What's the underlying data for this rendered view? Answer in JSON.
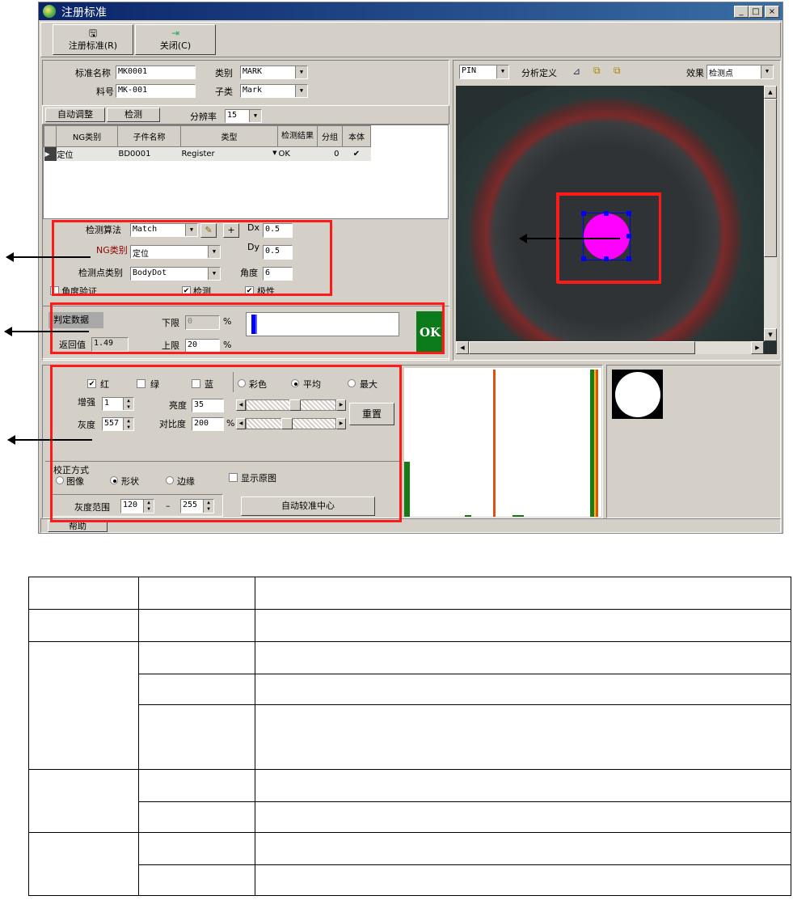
{
  "window": {
    "title": "注册标准",
    "min": "_",
    "max": "□",
    "close": "×"
  },
  "toolbar": {
    "register_label": "注册标准(R)",
    "close_label": "关闭(C)"
  },
  "standard": {
    "name_label": "标准名称",
    "name_value": "MK0001",
    "part_label": "料号",
    "part_value": "MK-001",
    "category_label": "类别",
    "category_value": "MARK",
    "subclass_label": "子类",
    "subclass_value": "Mark"
  },
  "actions": {
    "auto_adjust": "自动调整",
    "detect": "检测",
    "resolution_label": "分辨率",
    "resolution_value": "15"
  },
  "grid": {
    "headers": [
      "NG类别",
      "子件名称",
      "类型",
      "检测结果",
      "分组",
      "本体"
    ],
    "rows": [
      {
        "ng": "定位",
        "name": "BD0001",
        "type": "Register",
        "result": "OK",
        "group": "0",
        "body": "✔"
      }
    ]
  },
  "algo": {
    "method_label": "检测算法",
    "method_value": "Match",
    "ng_label": "NG类别",
    "ng_value": "定位",
    "point_label": "检测点类别",
    "point_value": "BodyDot",
    "dx_label": "Dx",
    "dx_value": "0.5",
    "dy_label": "Dy",
    "dy_value": "0.5",
    "angle_label": "角度",
    "angle_value": "6",
    "angle_verify": "角度验证",
    "detect_chk": "检测",
    "polarity": "极性"
  },
  "judge": {
    "data_label": "判定数据",
    "return_label": "返回值",
    "return_value": "1.49",
    "lower_label": "下限",
    "lower_value": "0",
    "upper_label": "上限",
    "upper_value": "20",
    "percent": "%",
    "result": "OK",
    "progress": 0.04
  },
  "image_panel": {
    "pin_value": "PIN",
    "analysis_label": "分析定义",
    "effect_label": "效果",
    "effect_value": "检测点"
  },
  "color": {
    "red": "红",
    "green": "绿",
    "blue": "蓝",
    "mode_color": "彩色",
    "mode_avg": "平均",
    "mode_max": "最大",
    "gain_label": "增强",
    "gain_value": "1",
    "gray_label": "灰度",
    "gray_value": "557",
    "bright_label": "亮度",
    "bright_value": "35",
    "contrast_label": "对比度",
    "contrast_value": "200",
    "percent": "%",
    "reset": "重置",
    "brightness_level": 0.55,
    "contrast_level": 0.45
  },
  "correction": {
    "title": "校正方式",
    "image": "图像",
    "shape": "形状",
    "edge": "边缘",
    "show_original": "显示原图",
    "range_label": "灰度范围",
    "range_min": "120",
    "dash": "–",
    "range_max": "255",
    "auto_center": "自动较准中心"
  },
  "status": {
    "help": "帮助"
  },
  "colors": {
    "accent_red": "#ff1a1a",
    "ok_green": "#0a7a1a",
    "target_magenta": "#ff00ff",
    "progress_blue": "#0000ff"
  }
}
